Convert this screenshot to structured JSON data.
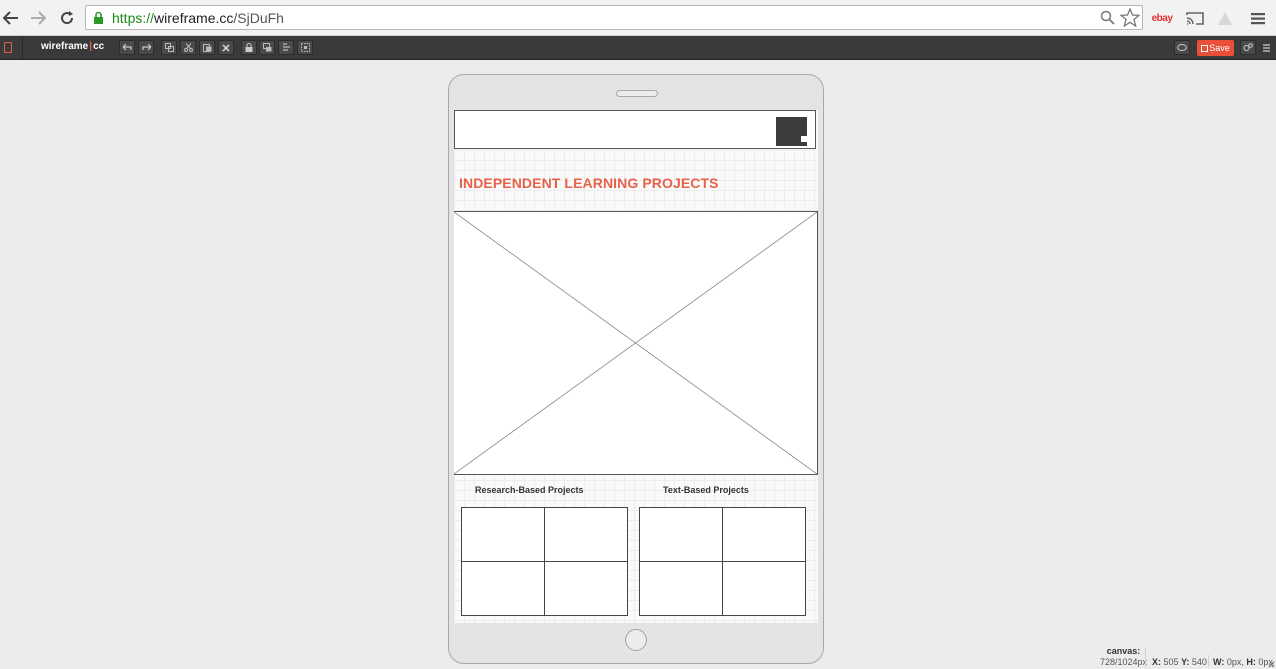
{
  "browser": {
    "url_scheme": "https://",
    "url_host": "wireframe.cc",
    "url_path": "/SjDuFh",
    "ext_ebay": "ebay"
  },
  "toolbar": {
    "brand_left": "wireframe",
    "brand_sep": "|",
    "brand_right": "cc",
    "save_label": "Save"
  },
  "canvas": {
    "heading": "INDEPENDENT LEARNING PROJECTS",
    "research_label": "Research-Based Projects",
    "text_label": "Text-Based Projects"
  },
  "status": {
    "canvas_label": "canvas:",
    "canvas_size": "728/1024px",
    "x_label": "X:",
    "x_value": "505",
    "y_label": "Y:",
    "y_value": "540",
    "w_label": "W:",
    "w_value": "0px,",
    "h_label": "H:",
    "h_value": "0px"
  },
  "colors": {
    "accent": "#e8624a",
    "save": "#e8503a",
    "toolbar": "#3a3a3a",
    "url_secure": "#1a8a1a"
  },
  "icons": [
    "back-arrow-icon",
    "forward-arrow-icon",
    "reload-icon",
    "lock-icon",
    "search-icon",
    "star-icon",
    "ebay-icon",
    "cast-icon",
    "warning-icon",
    "menu-icon",
    "device-icon",
    "undo-icon",
    "redo-icon",
    "copy-icon",
    "cut-icon",
    "paste-icon",
    "delete-icon",
    "lock-toggle-icon",
    "layer-icon",
    "align-icon",
    "group-icon",
    "comment-icon",
    "settings-icon",
    "hamburger-icon"
  ]
}
